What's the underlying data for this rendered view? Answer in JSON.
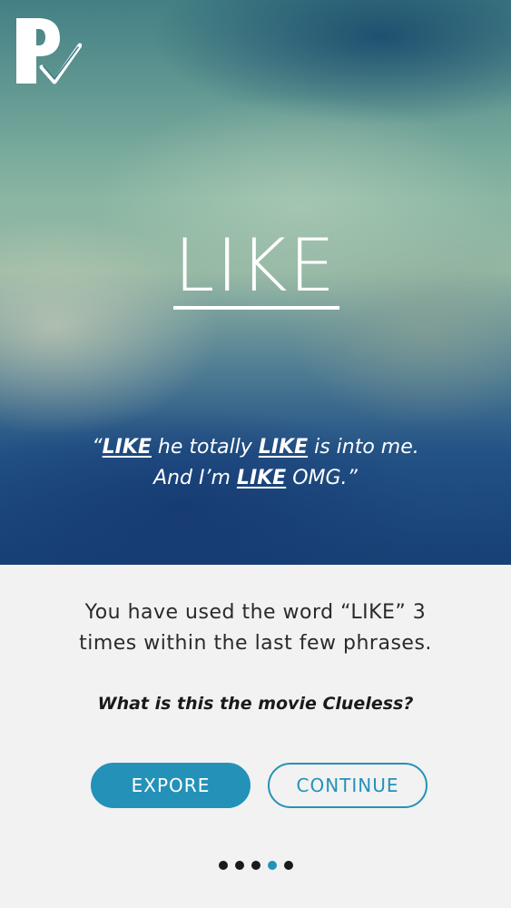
{
  "hero": {
    "word": "LIKE",
    "quote_line1": [
      {
        "text": "“",
        "bold": false
      },
      {
        "text": "LIKE",
        "bold": true
      },
      {
        "text": " he totally ",
        "bold": false
      },
      {
        "text": "LIKE",
        "bold": true
      },
      {
        "text": " is into me.",
        "bold": false
      }
    ],
    "quote_line2": [
      {
        "text": "And I’m ",
        "bold": false
      },
      {
        "text": "LIKE",
        "bold": true
      },
      {
        "text": " OMG.”",
        "bold": false
      }
    ]
  },
  "message": {
    "line1": "You have used the word “LIKE” 3",
    "line2": "times within the last few phrases."
  },
  "tagline": "What is this the movie Clueless?",
  "buttons": {
    "explore_label": "EXPORE",
    "continue_label": "CONTINUE"
  },
  "pagination": {
    "total": 5,
    "active_index": 3
  },
  "colors": {
    "accent": "#2492b8",
    "panel_bg": "#f2f2f2",
    "text": "#2a2a2a"
  },
  "icons": {
    "logo": "p-checkmark-logo-icon"
  }
}
